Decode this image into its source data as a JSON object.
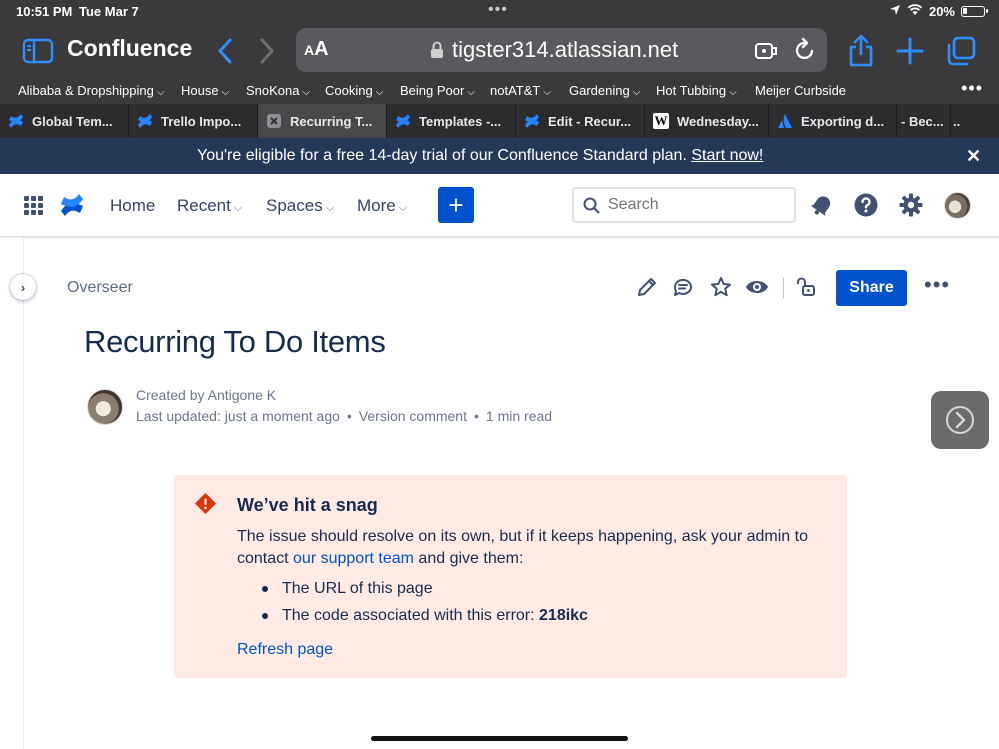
{
  "status_bar": {
    "time": "10:51 PM",
    "date": "Tue Mar 7",
    "battery": "20%"
  },
  "browser": {
    "app_title": "Confluence",
    "aa_label": "AA",
    "url": "tigster314.atlassian.net",
    "accent": "#2f8fff"
  },
  "favorites": [
    {
      "label": "Alibaba & Dropshipping",
      "has_menu": true
    },
    {
      "label": "House",
      "has_menu": true
    },
    {
      "label": "SnoKona",
      "has_menu": true
    },
    {
      "label": "Cooking",
      "has_menu": true
    },
    {
      "label": "Being Poor",
      "has_menu": true
    },
    {
      "label": "notAT&T",
      "has_menu": true
    },
    {
      "label": "Gardening",
      "has_menu": true
    },
    {
      "label": "Hot Tubbing",
      "has_menu": true
    },
    {
      "label": "Meijer Curbside",
      "has_menu": false
    }
  ],
  "tabs": [
    {
      "label": "Global Tem...",
      "icon": "confluence-icon"
    },
    {
      "label": "Trello Impo...",
      "icon": "confluence-icon"
    },
    {
      "label": "Recurring T...",
      "icon": "close-icon",
      "active": true
    },
    {
      "label": "Templates -...",
      "icon": "confluence-icon"
    },
    {
      "label": "Edit - Recur...",
      "icon": "confluence-icon"
    },
    {
      "label": "Wednesday...",
      "icon": "wikipedia-icon"
    },
    {
      "label": "Exporting d...",
      "icon": "atlassian-icon"
    },
    {
      "label": "- Bec...",
      "icon": ""
    },
    {
      "label": "..",
      "icon": ""
    }
  ],
  "banner": {
    "text": "You're eligible for a free 14-day trial of our Confluence Standard plan.",
    "link": "Start now!",
    "close": "✕"
  },
  "topnav": {
    "home": "Home",
    "recent": "Recent",
    "spaces": "Spaces",
    "more": "More",
    "create": "+",
    "search_placeholder": "Search"
  },
  "page": {
    "breadcrumb": "Overseer",
    "share": "Share",
    "title": "Recurring To Do Items",
    "created_by": "Created by Antigone K",
    "last_updated": "Last updated: just a moment ago",
    "version_comment": "Version comment",
    "read_time": "1 min read"
  },
  "error": {
    "title": "We’ve hit a snag",
    "body_before": "The issue should resolve on its own, but if it keeps happening, ask your admin to contact ",
    "body_link": "our support team",
    "body_after": " and give them:",
    "item1": "The URL of this page",
    "item2_label": "The code associated with this error: ",
    "item2_code": "218ikc",
    "refresh": "Refresh page"
  },
  "colors": {
    "primary": "#0052cc",
    "banner_bg": "#253858",
    "error_bg": "#ffebe6",
    "error_icon": "#de350b"
  }
}
